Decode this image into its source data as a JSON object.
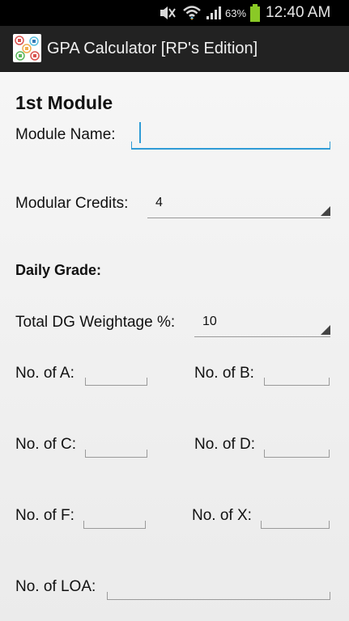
{
  "status_bar": {
    "icons": [
      "mute-icon",
      "wifi-icon",
      "signal-icon",
      "battery-icon"
    ],
    "battery_percent": "63%",
    "time": "12:40 AM"
  },
  "action_bar": {
    "app_icon": "app-logo-icon",
    "title": "GPA Calculator [RP's Edition]"
  },
  "form": {
    "module_heading": "1st Module",
    "module_name_label": "Module Name:",
    "module_name_value": "",
    "modular_credits_label": "Modular Credits:",
    "modular_credits_value": "4",
    "daily_grade_heading": "Daily Grade:",
    "dg_weightage_label": "Total DG Weightage %:",
    "dg_weightage_value": "10",
    "grades": {
      "a_label": "No. of A:",
      "b_label": "No. of B:",
      "c_label": "No. of C:",
      "d_label": "No. of D:",
      "f_label": "No. of F:",
      "x_label": "No. of X:",
      "loa_label": "No. of LOA:"
    }
  },
  "colors": {
    "accent": "#2f9bd6",
    "action_bar": "#222222",
    "status_bar": "#000000",
    "battery": "#8ac926"
  }
}
